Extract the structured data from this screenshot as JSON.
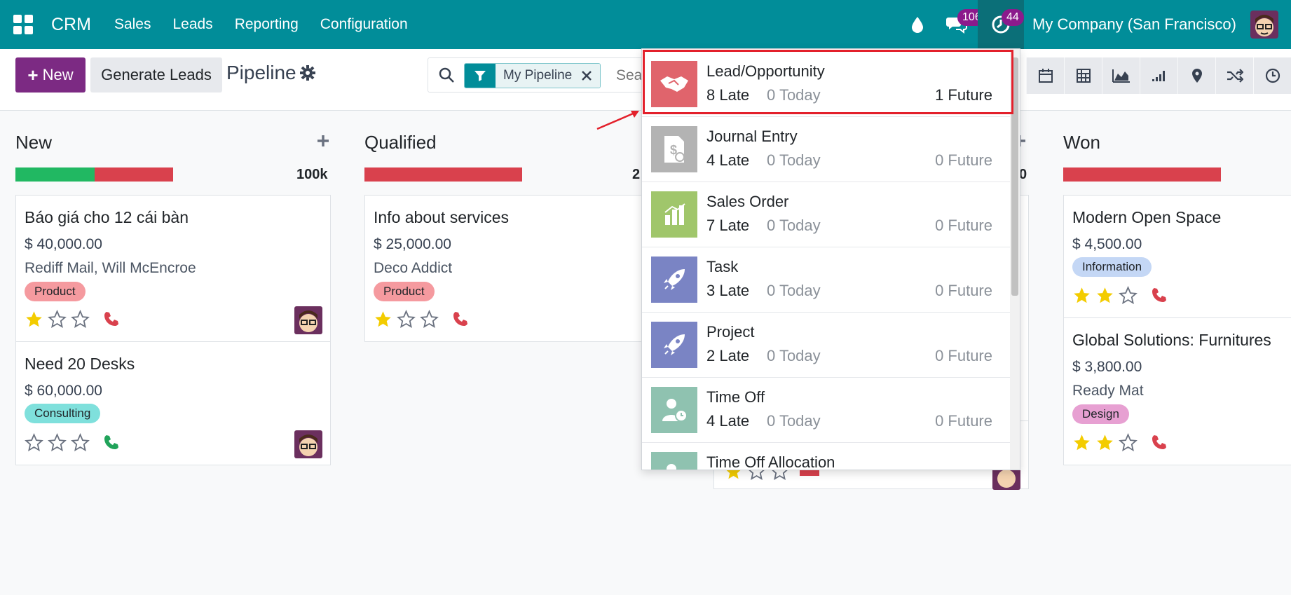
{
  "navbar": {
    "brand": "CRM",
    "menus": [
      "Sales",
      "Leads",
      "Reporting",
      "Configuration"
    ],
    "messages_badge": "106",
    "activities_badge": "44",
    "company": "My Company (San Francisco)"
  },
  "control": {
    "new_label": "New",
    "generate_label": "Generate Leads",
    "title": "Pipeline",
    "facet_label": "My Pipeline",
    "search_placeholder": "Search..."
  },
  "columns": [
    {
      "title": "New",
      "total": "100k",
      "cards": [
        {
          "title": "Báo giá cho 12 cái bàn",
          "amount": "$ 40,000.00",
          "partner": "Rediff Mail, Will McEncroe",
          "tag": "Product",
          "stars": 1,
          "phone": "red"
        },
        {
          "title": "Need 20 Desks",
          "amount": "$ 60,000.00",
          "partner": "",
          "tag": "Consulting",
          "stars": 0,
          "phone": "green"
        }
      ]
    },
    {
      "title": "Qualified",
      "total": "2",
      "cards": [
        {
          "title": "Info about services",
          "amount": "$ 25,000.00",
          "partner": "Deco Addict",
          "tag": "Product",
          "stars": 1,
          "phone": "red"
        }
      ]
    },
    {
      "title": "Won",
      "total": "",
      "cards": [
        {
          "title": "Modern Open Space",
          "amount": "$ 4,500.00",
          "partner": "",
          "tag": "Information",
          "stars": 2,
          "phone": "red"
        },
        {
          "title": "Global Solutions: Furnitures",
          "amount": "$ 3,800.00",
          "partner": "Ready Mat",
          "tag": "Design",
          "stars": 2,
          "phone": "red"
        }
      ]
    }
  ],
  "hidden_column_total_fragment": "0",
  "activities": [
    {
      "name": "Lead/Opportunity",
      "late": "8 Late",
      "today": "0 Today",
      "future": "1 Future",
      "color": "#e0646c",
      "icon": "handshake-icon"
    },
    {
      "name": "Journal Entry",
      "late": "4 Late",
      "today": "0 Today",
      "future": "0 Future",
      "color": "#b3b3b3",
      "icon": "invoice-icon"
    },
    {
      "name": "Sales Order",
      "late": "7 Late",
      "today": "0 Today",
      "future": "0 Future",
      "color": "#a0c66b",
      "icon": "chart-icon"
    },
    {
      "name": "Task",
      "late": "3 Late",
      "today": "0 Today",
      "future": "0 Future",
      "color": "#7a84c4",
      "icon": "rocket-icon"
    },
    {
      "name": "Project",
      "late": "2 Late",
      "today": "0 Today",
      "future": "0 Future",
      "color": "#7a84c4",
      "icon": "rocket-icon"
    },
    {
      "name": "Time Off",
      "late": "4 Late",
      "today": "0 Today",
      "future": "0 Future",
      "color": "#8fc2b0",
      "icon": "person-clock-icon"
    },
    {
      "name": "Time Off Allocation",
      "late": "",
      "today": "",
      "future": "",
      "color": "#8fc2b0",
      "icon": "person-icon"
    }
  ],
  "colors": {
    "navbar": "#018d99",
    "primary": "#7c2a83",
    "late_bar": "#d9414d",
    "ok_bar": "#21b862",
    "highlight": "#e3202b"
  }
}
